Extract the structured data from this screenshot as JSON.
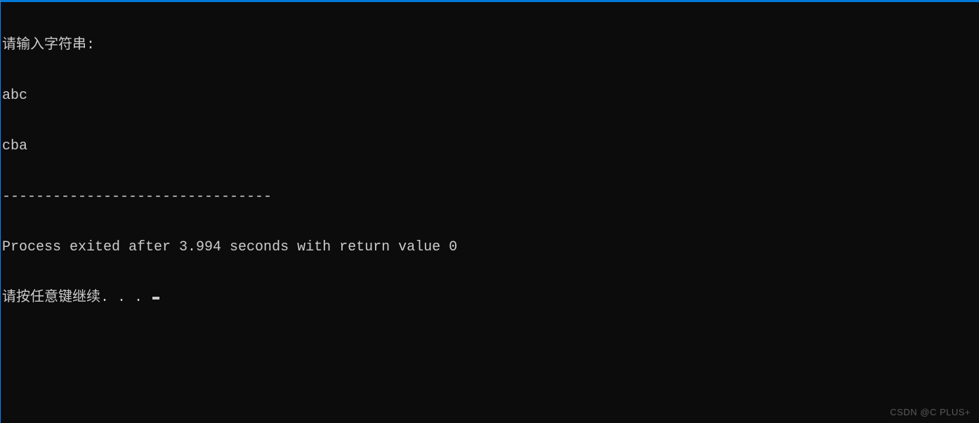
{
  "console": {
    "lines": {
      "prompt": "请输入字符串:",
      "input": "abc",
      "output": "cba",
      "separator": "--------------------------------",
      "exit_message": "Process exited after 3.994 seconds with return value 0",
      "continue_prompt": "请按任意键继续. . . "
    }
  },
  "watermark": "CSDN @C PLUS+"
}
